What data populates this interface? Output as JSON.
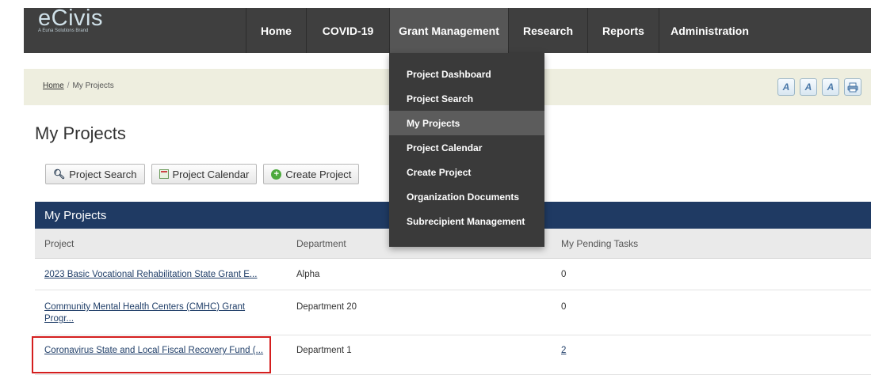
{
  "logo": {
    "name": "eCivis",
    "tagline": "A Euna Solutions Brand"
  },
  "nav": {
    "items": [
      {
        "label": "Home",
        "active": false
      },
      {
        "label": "COVID-19",
        "active": false
      },
      {
        "label": "Grant Management",
        "active": true
      },
      {
        "label": "Research",
        "active": false
      },
      {
        "label": "Reports",
        "active": false
      },
      {
        "label": "Administration",
        "active": false
      }
    ]
  },
  "breadcrumb": {
    "home": "Home",
    "separator": "/",
    "current": "My Projects"
  },
  "tools": [
    "font-size-icon",
    "font-italic-icon",
    "font-reset-icon",
    "print-icon"
  ],
  "page_title": "My Projects",
  "actions": {
    "search": "Project Search",
    "calendar": "Project Calendar",
    "create": "Create Project"
  },
  "dropdown": {
    "items": [
      {
        "label": "Project Dashboard",
        "active": false
      },
      {
        "label": "Project Search",
        "active": false
      },
      {
        "label": "My Projects",
        "active": true
      },
      {
        "label": "Project Calendar",
        "active": false
      },
      {
        "label": "Create Project",
        "active": false
      },
      {
        "label": "Organization Documents",
        "active": false
      },
      {
        "label": "Subrecipient Management",
        "active": false
      }
    ]
  },
  "table": {
    "title": "My Projects",
    "columns": [
      "Project",
      "Department",
      "My Pending Tasks"
    ],
    "rows": [
      {
        "project": "2023 Basic Vocational Rehabilitation State Grant E...",
        "department": "Alpha",
        "tasks": "0"
      },
      {
        "project": "Community Mental Health Centers (CMHC) Grant Progr...",
        "department": "Department 20",
        "tasks": "0"
      },
      {
        "project": "Coronavirus State and Local Fiscal Recovery Fund (...",
        "department": "Department 1",
        "tasks": "2"
      }
    ]
  },
  "colors": {
    "nav_bg": "#3f3f3f",
    "panel_header": "#1f3a63",
    "breadcrumb_bg": "#eeeedf",
    "highlight": "#d41e1e"
  }
}
